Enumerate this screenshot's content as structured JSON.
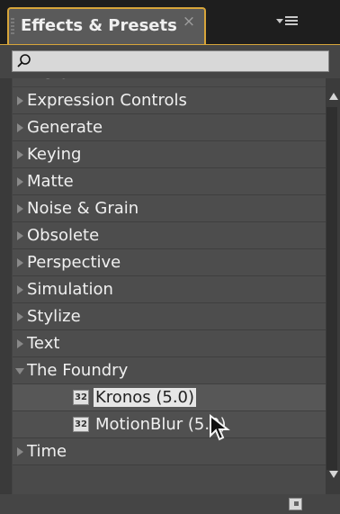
{
  "panel": {
    "title": "Effects & Presets",
    "close_glyph": "×",
    "search_value": "",
    "search_placeholder": ""
  },
  "tree": {
    "partial_item": "Distort",
    "items": [
      {
        "label": "Expression Controls",
        "expanded": false
      },
      {
        "label": "Generate",
        "expanded": false
      },
      {
        "label": "Keying",
        "expanded": false
      },
      {
        "label": "Matte",
        "expanded": false
      },
      {
        "label": "Noise & Grain",
        "expanded": false
      },
      {
        "label": "Obsolete",
        "expanded": false
      },
      {
        "label": "Perspective",
        "expanded": false
      },
      {
        "label": "Simulation",
        "expanded": false
      },
      {
        "label": "Stylize",
        "expanded": false
      },
      {
        "label": "Text",
        "expanded": false
      },
      {
        "label": "The Foundry",
        "expanded": true
      },
      {
        "label": "Time",
        "expanded": false
      }
    ],
    "foundry_children": [
      {
        "badge": "32",
        "label": "Kronos (5.0)",
        "selected": true
      },
      {
        "badge": "32",
        "label": "MotionBlur (5.0)",
        "selected": false
      }
    ]
  },
  "icons": {
    "search": "search-icon",
    "panel_menu": "panel-menu-icon",
    "new_folder": "new-folder-icon",
    "cursor": "mouse-pointer-icon"
  },
  "colors": {
    "tab_accent": "#d7a53a",
    "panel_bg": "#3a3a3a",
    "row_bg": "#4d4d4d",
    "text": "#f0f0f0"
  }
}
